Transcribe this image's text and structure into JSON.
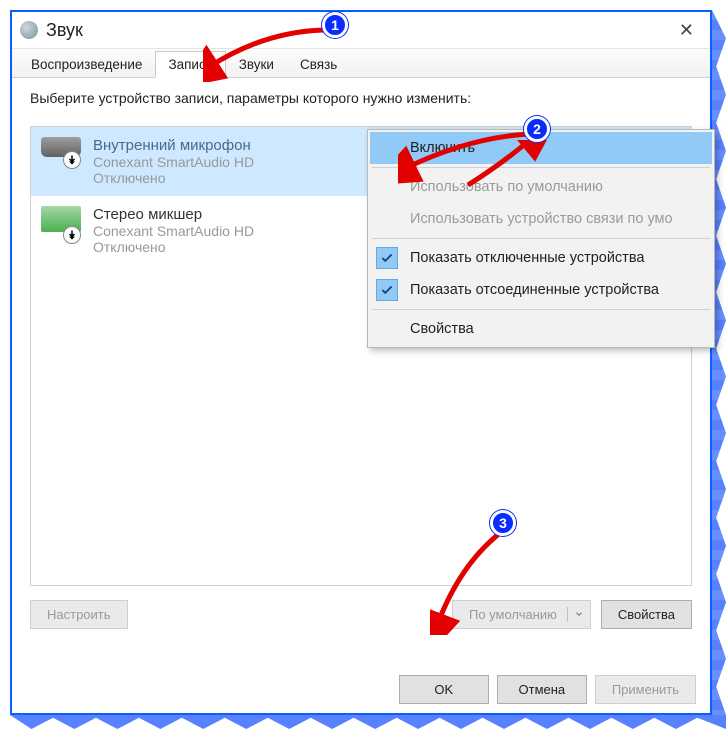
{
  "window": {
    "title": "Звук",
    "close_label": "✕"
  },
  "tabs": {
    "playback": "Воспроизведение",
    "recording": "Запись",
    "sounds": "Звуки",
    "communications": "Связь"
  },
  "instruction": "Выберите устройство записи, параметры которого нужно изменить:",
  "devices": [
    {
      "name": "Внутренний микрофон",
      "driver": "Conexant SmartAudio HD",
      "status": "Отключено"
    },
    {
      "name": "Стерео микшер",
      "driver": "Conexant SmartAudio HD",
      "status": "Отключено"
    }
  ],
  "context_menu": {
    "enable": "Включить",
    "set_default": "Использовать по умолчанию",
    "set_comm_default": "Использовать устройство связи по умо",
    "show_disabled": "Показать отключенные устройства",
    "show_disconnected": "Показать отсоединенные устройства",
    "properties": "Свойства"
  },
  "buttons": {
    "configure": "Настроить",
    "set_default": "По умолчанию",
    "properties": "Свойства",
    "ok": "OK",
    "cancel": "Отмена",
    "apply": "Применить"
  },
  "annotations": {
    "b1": "1",
    "b2": "2",
    "b3": "3"
  }
}
